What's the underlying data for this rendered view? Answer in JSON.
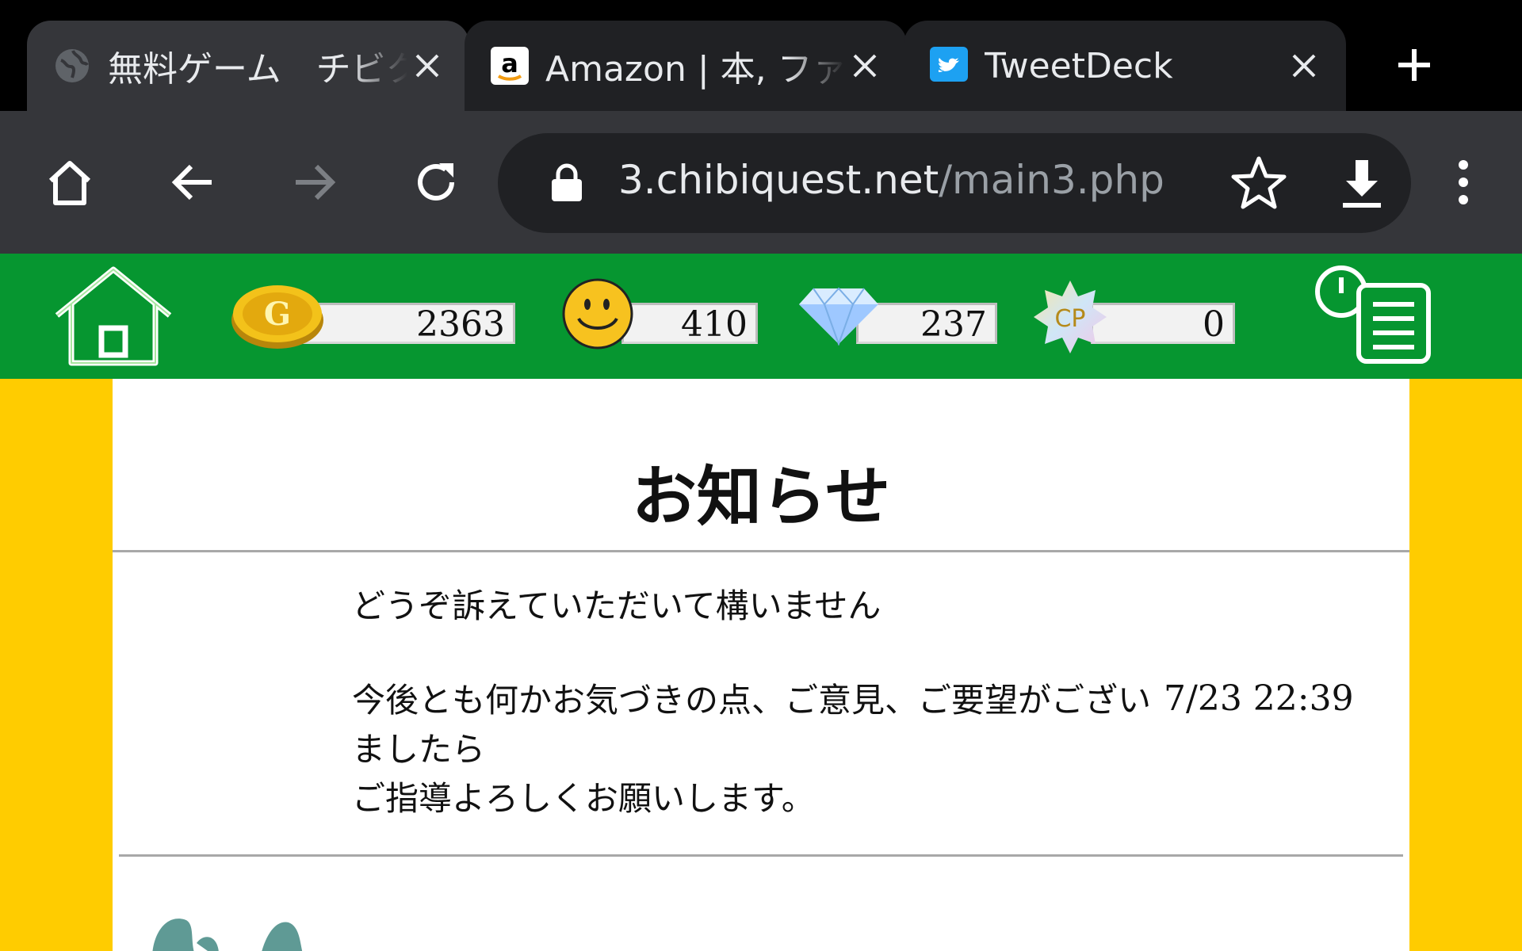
{
  "browser": {
    "tabs": [
      {
        "title": "無料ゲーム　チビクエスト",
        "favicon": "globe-icon",
        "active": true
      },
      {
        "title": "Amazon | 本, ファッション",
        "favicon": "amazon-icon",
        "active": false
      },
      {
        "title": "TweetDeck",
        "favicon": "twitter-icon",
        "active": false
      }
    ],
    "url_domain": "3.chibiquest.net",
    "url_path": "/main3.php"
  },
  "game": {
    "gold": "2363",
    "smile": "410",
    "diamond": "237",
    "cp": "0",
    "cp_label": "CP",
    "gold_label": "G"
  },
  "notice": {
    "title": "お知らせ",
    "headline": "どうぞ訴えていただいて構いません",
    "body": "今後とも何かお気づきの点、ご意見、ご要望がございましたら\nご指導よろしくお願いします。",
    "timestamp": "7/23 22:39"
  },
  "colors": {
    "game_green": "#069630",
    "page_yellow": "#ffcc00",
    "toolbar": "#35363a",
    "omnibox": "#202124"
  }
}
